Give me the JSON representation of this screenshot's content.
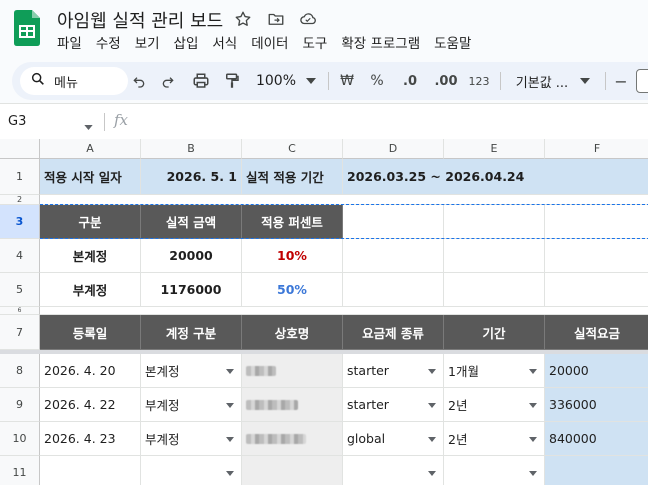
{
  "app": {
    "doc_title": "아임웹 실적 관리 보드",
    "menu": [
      "파일",
      "수정",
      "보기",
      "삽입",
      "서식",
      "데이터",
      "도구",
      "확장 프로그램",
      "도움말"
    ],
    "brand_color": "#0f9d58",
    "header_fill": "#595959",
    "accent_fill": "#cfe2f3"
  },
  "toolbar": {
    "search_label": "메뉴",
    "zoom": "100%",
    "currency": "₩",
    "percent": "%",
    "dec_decrease": ".0",
    "dec_increase": ".00",
    "number_format": "123",
    "font": "기본값 ...",
    "minus": "−"
  },
  "formula_bar": {
    "cell_ref": "G3",
    "fx": "fx",
    "value": ""
  },
  "columns": [
    "A",
    "B",
    "C",
    "D",
    "E",
    "F"
  ],
  "rows": {
    "r1": "1",
    "r2": "2",
    "r3": "3",
    "r4": "4",
    "r5": "5",
    "r6": "6",
    "r7": "7",
    "r8": "8",
    "r9": "9",
    "r10": "10",
    "r11": "11"
  },
  "info": {
    "start_label": "적용 시작 일자",
    "start_value": "2026. 5. 1",
    "period_label": "실적 적용 기간",
    "period_value": "2026.03.25 ~ 2026.04.24"
  },
  "summary": {
    "headers": [
      "구분",
      "실적 금액",
      "적용 퍼센트"
    ],
    "rows": [
      {
        "type": "본계정",
        "amount": "20000",
        "percent": "10%",
        "percent_color": "#c00000"
      },
      {
        "type": "부계정",
        "amount": "1176000",
        "percent": "50%",
        "percent_color": "#3c78d8"
      }
    ]
  },
  "table": {
    "headers": [
      "등록일",
      "계정 구분",
      "상호명",
      "요금제 종류",
      "기간",
      "실적요금"
    ],
    "rows": [
      {
        "date": "2026. 4. 20",
        "account": "본계정",
        "plan": "starter",
        "period": "1개월",
        "fee": "20000"
      },
      {
        "date": "2026. 4. 22",
        "account": "부계정",
        "plan": "starter",
        "period": "2년",
        "fee": "336000"
      },
      {
        "date": "2026. 4. 23",
        "account": "부계정",
        "plan": "global",
        "period": "2년",
        "fee": "840000"
      },
      {
        "date": "",
        "account": "",
        "plan": "",
        "period": "",
        "fee": ""
      }
    ]
  },
  "icons": [
    "star-icon",
    "move-to-folder-icon",
    "cloud-status-icon",
    "search-icon",
    "undo-icon",
    "redo-icon",
    "print-icon",
    "paint-format-icon",
    "chevron-down-icon"
  ]
}
